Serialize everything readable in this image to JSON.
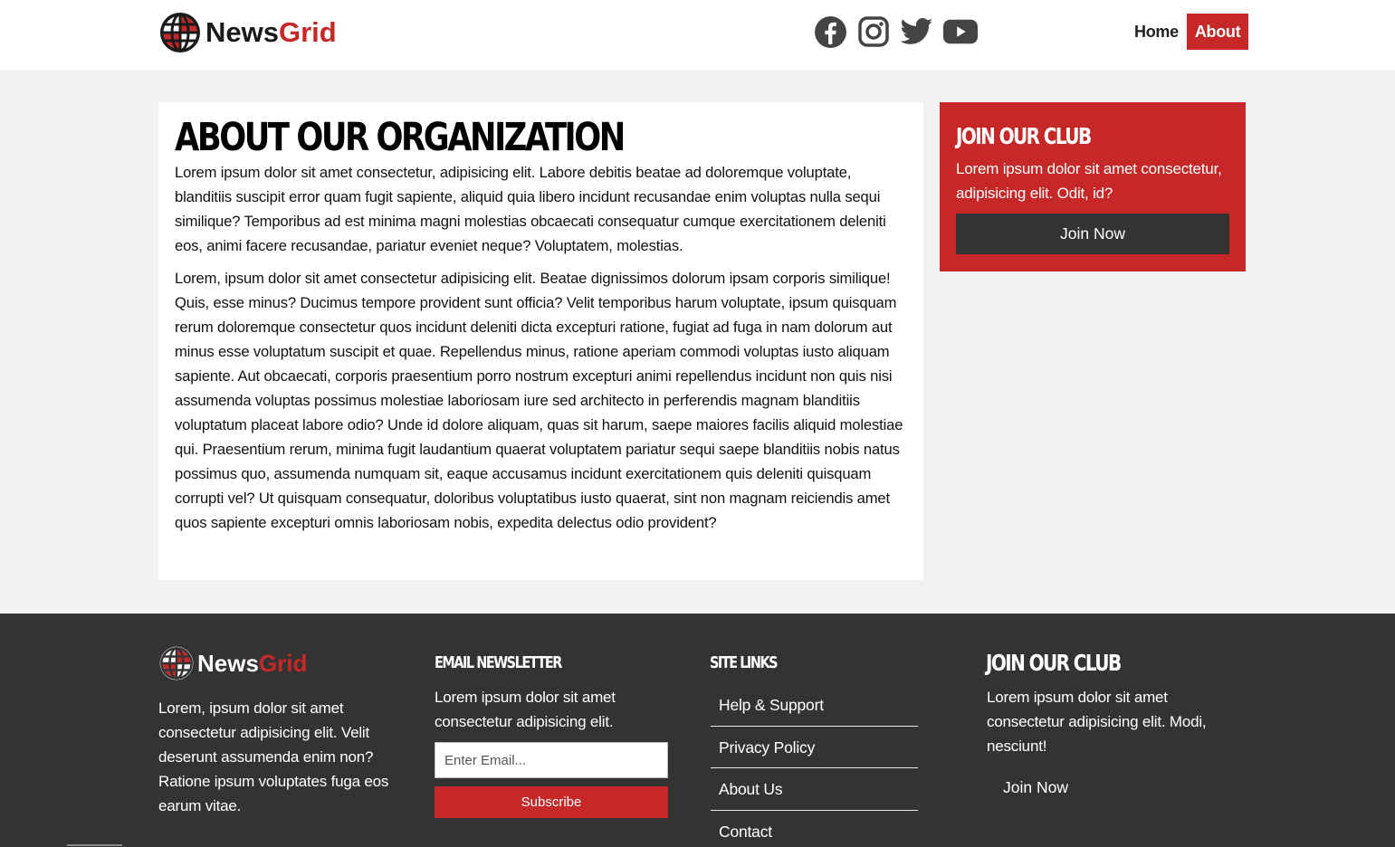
{
  "header": {
    "logo": {
      "part1": "News",
      "part2": "Grid"
    },
    "social": [
      {
        "name": "facebook-icon"
      },
      {
        "name": "instagram-icon"
      },
      {
        "name": "twitter-icon"
      },
      {
        "name": "youtube-icon"
      }
    ],
    "nav": {
      "home": "Home",
      "about": "About"
    }
  },
  "article": {
    "title": "About Our Organization",
    "paragraphs": [
      "Lorem ipsum dolor sit amet consectetur, adipisicing elit. Labore debitis beatae ad doloremque voluptate, blanditiis suscipit error quam fugit sapiente, aliquid quia libero incidunt recusandae enim voluptas nulla sequi similique? Temporibus ad est minima magni molestias obcaecati consequatur cumque exercitationem deleniti eos, animi facere recusandae, pariatur eveniet neque? Voluptatem, molestias.",
      "Lorem, ipsum dolor sit amet consectetur adipisicing elit. Beatae dignissimos dolorum ipsam corporis similique! Quis, esse minus? Ducimus tempore provident sunt officia? Velit temporibus harum voluptate, ipsum quisquam rerum doloremque consectetur quos incidunt deleniti dicta excepturi ratione, fugiat ad fuga in nam dolorum aut minus esse voluptatum suscipit et quae. Repellendus minus, ratione aperiam commodi voluptas iusto aliquam sapiente. Aut obcaecati, corporis praesentium porro nostrum excepturi animi repellendus incidunt non quis nisi assumenda voluptas possimus molestiae laboriosam iure sed architecto in perferendis magnam blanditiis voluptatum placeat labore odio? Unde id dolore aliquam, quas sit harum, saepe maiores facilis aliquid molestiae qui. Praesentium rerum, minima fugit laudantium quaerat voluptatem pariatur sequi saepe blanditiis nobis natus possimus quo, assumenda numquam sit, eaque accusamus incidunt exercitationem quis deleniti quisquam corrupti vel? Ut quisquam consequatur, doloribus voluptatibus iusto quaerat, sint non magnam reiciendis amet quos sapiente excepturi omnis laboriosam nobis, expedita delectus odio provident?"
    ]
  },
  "sidebar": {
    "title": "Join Our Club",
    "text": "Lorem ipsum dolor sit amet consectetur, adipisicing elit. Odit, id?",
    "button": "Join Now"
  },
  "footer": {
    "logo": {
      "part1": "News",
      "part2": "Grid"
    },
    "about_text": "Lorem, ipsum dolor sit amet consectetur adipisicing elit. Velit deserunt assumenda enim non? Ratione ipsum voluptates fuga eos earum vitae.",
    "newsletter": {
      "title": "Email Newsletter",
      "text": "Lorem ipsum dolor sit amet consectetur adipisicing elit.",
      "placeholder": "Enter Email...",
      "button": "Subscribe"
    },
    "site_links": {
      "title": "Site Links",
      "items": [
        "Help & Support",
        "Privacy Policy",
        "About Us",
        "Contact"
      ]
    },
    "club": {
      "title": "Join Our Club",
      "text": "Lorem ipsum dolor sit amet consectetur adipisicing elit. Modi, nesciunt!",
      "button": "Join Now"
    }
  },
  "colors": {
    "brand_red": "#c62828",
    "dark": "#333333",
    "page_bg": "#f2f2f2"
  }
}
